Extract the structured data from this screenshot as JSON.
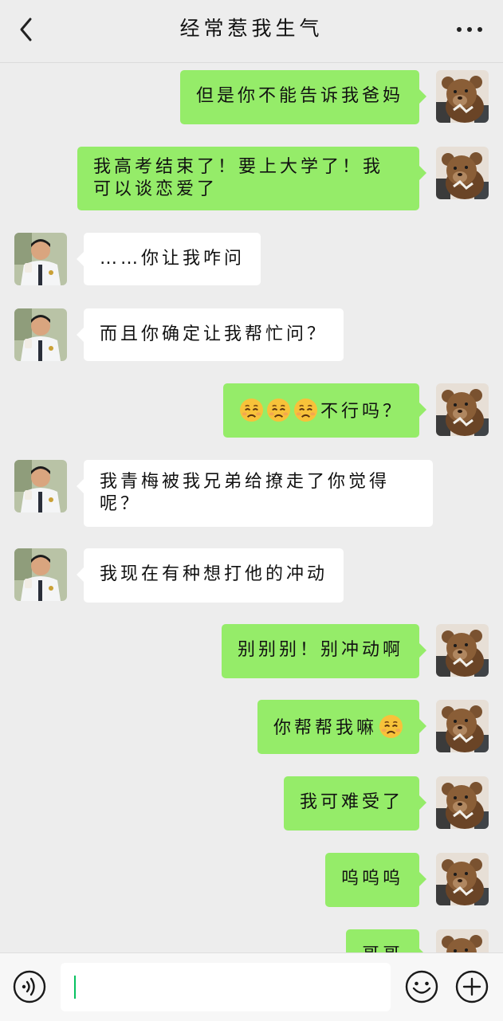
{
  "header": {
    "title": "经常惹我生气"
  },
  "messages": [
    {
      "side": "right",
      "text": "但是你不能告诉我爸妈"
    },
    {
      "side": "right",
      "text": "我高考结束了！要上大学了！我可以谈恋爱了"
    },
    {
      "side": "left",
      "text": "……你让我咋问"
    },
    {
      "side": "left",
      "text": "而且你确定让我帮忙问？"
    },
    {
      "side": "right",
      "emoji_count": 3,
      "emoji": "pleading-face-emoji",
      "text": "不行吗？"
    },
    {
      "side": "left",
      "text": "我青梅被我兄弟给撩走了你觉得呢？"
    },
    {
      "side": "left",
      "text": "我现在有种想打他的冲动"
    },
    {
      "side": "right",
      "text": "别别别！别冲动啊"
    },
    {
      "side": "right",
      "text": "你帮帮我嘛",
      "emoji_after": "pleading-face-emoji"
    },
    {
      "side": "right",
      "text": "我可难受了"
    },
    {
      "side": "right",
      "text": "呜呜呜"
    },
    {
      "side": "right",
      "text": "哥哥"
    }
  ],
  "avatars": {
    "self": "teddy-bear-avatar",
    "contact": "man-in-shirt-tie-avatar"
  },
  "input": {
    "value": ""
  },
  "colors": {
    "background": "#ededed",
    "self_bubble": "#95ec69",
    "other_bubble": "#ffffff",
    "caret": "#07c160"
  }
}
